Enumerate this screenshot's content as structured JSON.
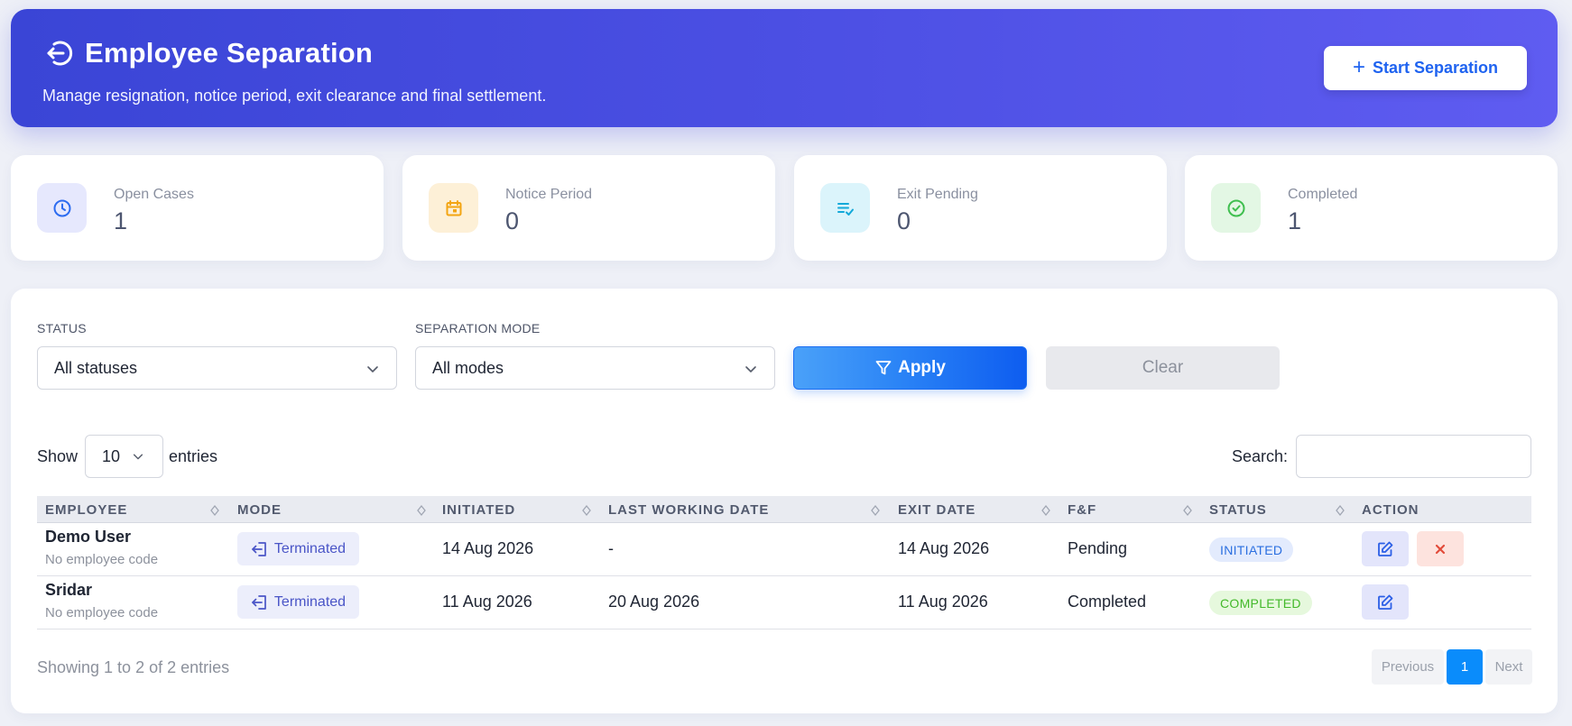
{
  "header": {
    "title": "Employee Separation",
    "subtitle": "Manage resignation, notice period, exit clearance and final settlement.",
    "start_button": "Start Separation"
  },
  "stats": [
    {
      "label": "Open Cases",
      "value": "1",
      "icon": "clock-icon",
      "color": "#2d6cf0",
      "bg": "#e6e8fd"
    },
    {
      "label": "Notice Period",
      "value": "0",
      "icon": "calendar-icon",
      "color": "#f3a512",
      "bg": "#fdf0d7"
    },
    {
      "label": "Exit Pending",
      "value": "0",
      "icon": "checklist-icon",
      "color": "#13a9d9",
      "bg": "#dbf4fb"
    },
    {
      "label": "Completed",
      "value": "1",
      "icon": "check-circle-icon",
      "color": "#3fbf4f",
      "bg": "#e3f7e4"
    }
  ],
  "filters": {
    "status_label": "STATUS",
    "status_value": "All statuses",
    "mode_label": "SEPARATION MODE",
    "mode_value": "All modes",
    "apply": "Apply",
    "clear": "Clear"
  },
  "table_controls": {
    "show": "Show",
    "length": "10",
    "entries": "entries",
    "search_label": "Search:"
  },
  "columns": [
    "EMPLOYEE",
    "MODE",
    "INITIATED",
    "LAST WORKING DATE",
    "EXIT DATE",
    "F&F",
    "STATUS",
    "ACTION"
  ],
  "rows": [
    {
      "name": "Demo User",
      "code": "No employee code",
      "mode": "Terminated",
      "initiated": "14 Aug 2026",
      "last_working": "-",
      "exit_date": "14 Aug 2026",
      "ff": "Pending",
      "status": "INITIATED",
      "status_color": "#2b6fe0",
      "status_bg": "#e3ebfd"
    },
    {
      "name": "Sridar",
      "code": "No employee code",
      "mode": "Terminated",
      "initiated": "11 Aug 2026",
      "last_working": "20 Aug 2026",
      "exit_date": "11 Aug 2026",
      "ff": "Completed",
      "status": "COMPLETED",
      "status_color": "#43b92a",
      "status_bg": "#e6f8dd"
    }
  ],
  "footer": {
    "info": "Showing 1 to 2 of 2 entries",
    "previous": "Previous",
    "page": "1",
    "next": "Next"
  },
  "colors": {
    "accent": "#0a8cfb",
    "brand_gradient_start": "#3a45d6",
    "brand_gradient_end": "#5f5cf1"
  }
}
